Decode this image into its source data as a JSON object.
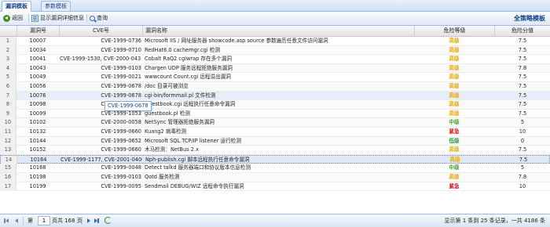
{
  "tabs": [
    {
      "label": "漏洞模板",
      "active": true
    },
    {
      "label": "参数模板",
      "active": false
    }
  ],
  "toolbar": {
    "back_label": "返回",
    "details_label": "显示漏洞详细信息",
    "query_label": "查询",
    "strategy_label": "全策略模板"
  },
  "columns": [
    "漏洞号",
    "CVE号",
    "漏洞名称",
    "危险等级",
    "危险分值"
  ],
  "level_colors": {
    "高级": "#e8a800",
    "中级": "#4aa02c",
    "紧急": "#d21111",
    "低级": "#2b9a3a"
  },
  "rows": [
    {
      "idx": "1",
      "id": "10007",
      "cve": "CVE-1999-0736",
      "name": "Microsoft IIS / 网址服务器 showcode.asp source 参数遍历任意文件访问漏洞",
      "level": "高级",
      "score": "7.5"
    },
    {
      "idx": "2",
      "id": "10034",
      "cve": "CVE-1999-0710",
      "name": "RedHat6.0 cachemgr.cgi 检测",
      "level": "高级",
      "score": "7.5"
    },
    {
      "idx": "3",
      "id": "10041",
      "cve": "CVE-1999-1530, CVE-2000-0431",
      "name": "Cobalt RaQ2 cgiwrap 存在多个漏洞",
      "level": "高级",
      "score": "7.5"
    },
    {
      "idx": "4",
      "id": "10043",
      "cve": "CVE-1999-0103",
      "name": "Chargen UDP 服务远程拒绝服务漏洞",
      "level": "高级",
      "score": "7.8"
    },
    {
      "idx": "5",
      "id": "10049",
      "cve": "CVE-1999-0021",
      "name": "wwwcount Count.cgi 远程溢出漏洞",
      "level": "高级",
      "score": "7.5"
    },
    {
      "idx": "6",
      "id": "10056",
      "cve": "CVE-1999-0678",
      "name": "/doc 目录可被浏览",
      "level": "高级",
      "score": "7.5"
    },
    {
      "idx": "7",
      "id": "10076",
      "cve": "CVE-1999-0678",
      "name": "cgi-bin/formmail.pl 文件检测",
      "level": "高级",
      "score": "7.5"
    },
    {
      "idx": "8",
      "id": "10098",
      "cve": "CVE-1999-0237",
      "name": "Guestbook.cgi 远程执行任意命令漏洞",
      "level": "高级",
      "score": "7.5"
    },
    {
      "idx": "9",
      "id": "10099",
      "cve": "CVE-1999-1053",
      "name": "guestbook.pl 检测",
      "level": "高级",
      "score": "7.5"
    },
    {
      "idx": "10",
      "id": "10102",
      "cve": "CVE-2000-0058",
      "name": "NetSync 管理器拒绝服务漏洞",
      "level": "中级",
      "score": "5"
    },
    {
      "idx": "11",
      "id": "10132",
      "cve": "CVE-1999-0660",
      "name": "Kuang2 病毒检测",
      "level": "紧急",
      "score": "10"
    },
    {
      "idx": "12",
      "id": "10144",
      "cve": "CVE-1999-0652",
      "name": "Microsoft SQL TCP/IP listener 运行检测",
      "level": "低级",
      "score": "0"
    },
    {
      "idx": "13",
      "id": "10152",
      "cve": "CVE-1999-0660",
      "name": "木马检测：NetBus 2.x",
      "level": "高级",
      "score": "7.5"
    },
    {
      "idx": "14",
      "id": "10164",
      "cve": "CVE-1999-1177, CVE-2001-0400",
      "name": "Nph-publish.cgi 脚本远程执行任意命令漏洞",
      "level": "高级",
      "score": "7.5"
    },
    {
      "idx": "15",
      "id": "10168",
      "cve": "CVE-1999-0048",
      "name": "Detect talkd 服务器端口和协议版本信息检测",
      "level": "中级",
      "score": "5"
    },
    {
      "idx": "16",
      "id": "10198",
      "cve": "CVE-1999-0103",
      "name": "Qotd 服务检测",
      "level": "高级",
      "score": "7.8"
    },
    {
      "idx": "17",
      "id": "10199",
      "cve": "CVE-1999-0095",
      "name": "Sendmail DEBUG/WIZ 远程命令执行漏洞",
      "level": "紧急",
      "score": "10"
    }
  ],
  "tooltip": "CVE-1999-0678",
  "paging": {
    "page_prefix": "第",
    "current_page": "1",
    "page_suffix": "页共 168 页",
    "summary": "显示第 1 条到 25 条记录，一共 4186 条"
  }
}
